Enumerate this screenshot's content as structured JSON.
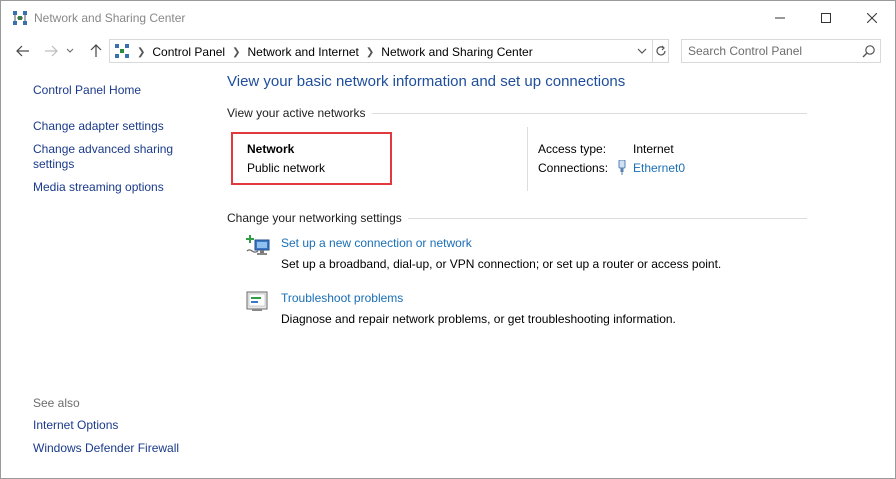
{
  "window": {
    "title": "Network and Sharing Center"
  },
  "address": {
    "crumbs": [
      "Control Panel",
      "Network and Internet",
      "Network and Sharing Center"
    ]
  },
  "search": {
    "placeholder": "Search Control Panel"
  },
  "left_pane": {
    "home": "Control Panel Home",
    "links": [
      "Change adapter settings",
      "Change advanced sharing settings",
      "Media streaming options"
    ],
    "see_also_label": "See also",
    "see_also": [
      "Internet Options",
      "Windows Defender Firewall"
    ]
  },
  "main": {
    "heading": "View your basic network information and set up connections",
    "active_networks_label": "View your active networks",
    "network": {
      "name": "Network",
      "type": "Public network",
      "access_type_label": "Access type:",
      "access_type_value": "Internet",
      "connections_label": "Connections:",
      "connections_value": "Ethernet0"
    },
    "change_settings_label": "Change your networking settings",
    "tasks": [
      {
        "title": "Set up a new connection or network",
        "description": "Set up a broadband, dial-up, or VPN connection; or set up a router or access point."
      },
      {
        "title": "Troubleshoot problems",
        "description": "Diagnose and repair network problems, or get troubleshooting information."
      }
    ]
  },
  "icons": {
    "app": "network-icon",
    "back": "back-arrow-icon",
    "forward": "forward-arrow-icon",
    "up": "up-arrow-icon",
    "refresh": "refresh-icon",
    "search": "search-icon",
    "ethernet": "ethernet-icon",
    "new_connection": "new-connection-icon",
    "troubleshoot": "troubleshoot-icon"
  },
  "colors": {
    "link": "#1a6fb5",
    "heading": "#1e4e9c",
    "highlight_border": "#e0393e"
  }
}
